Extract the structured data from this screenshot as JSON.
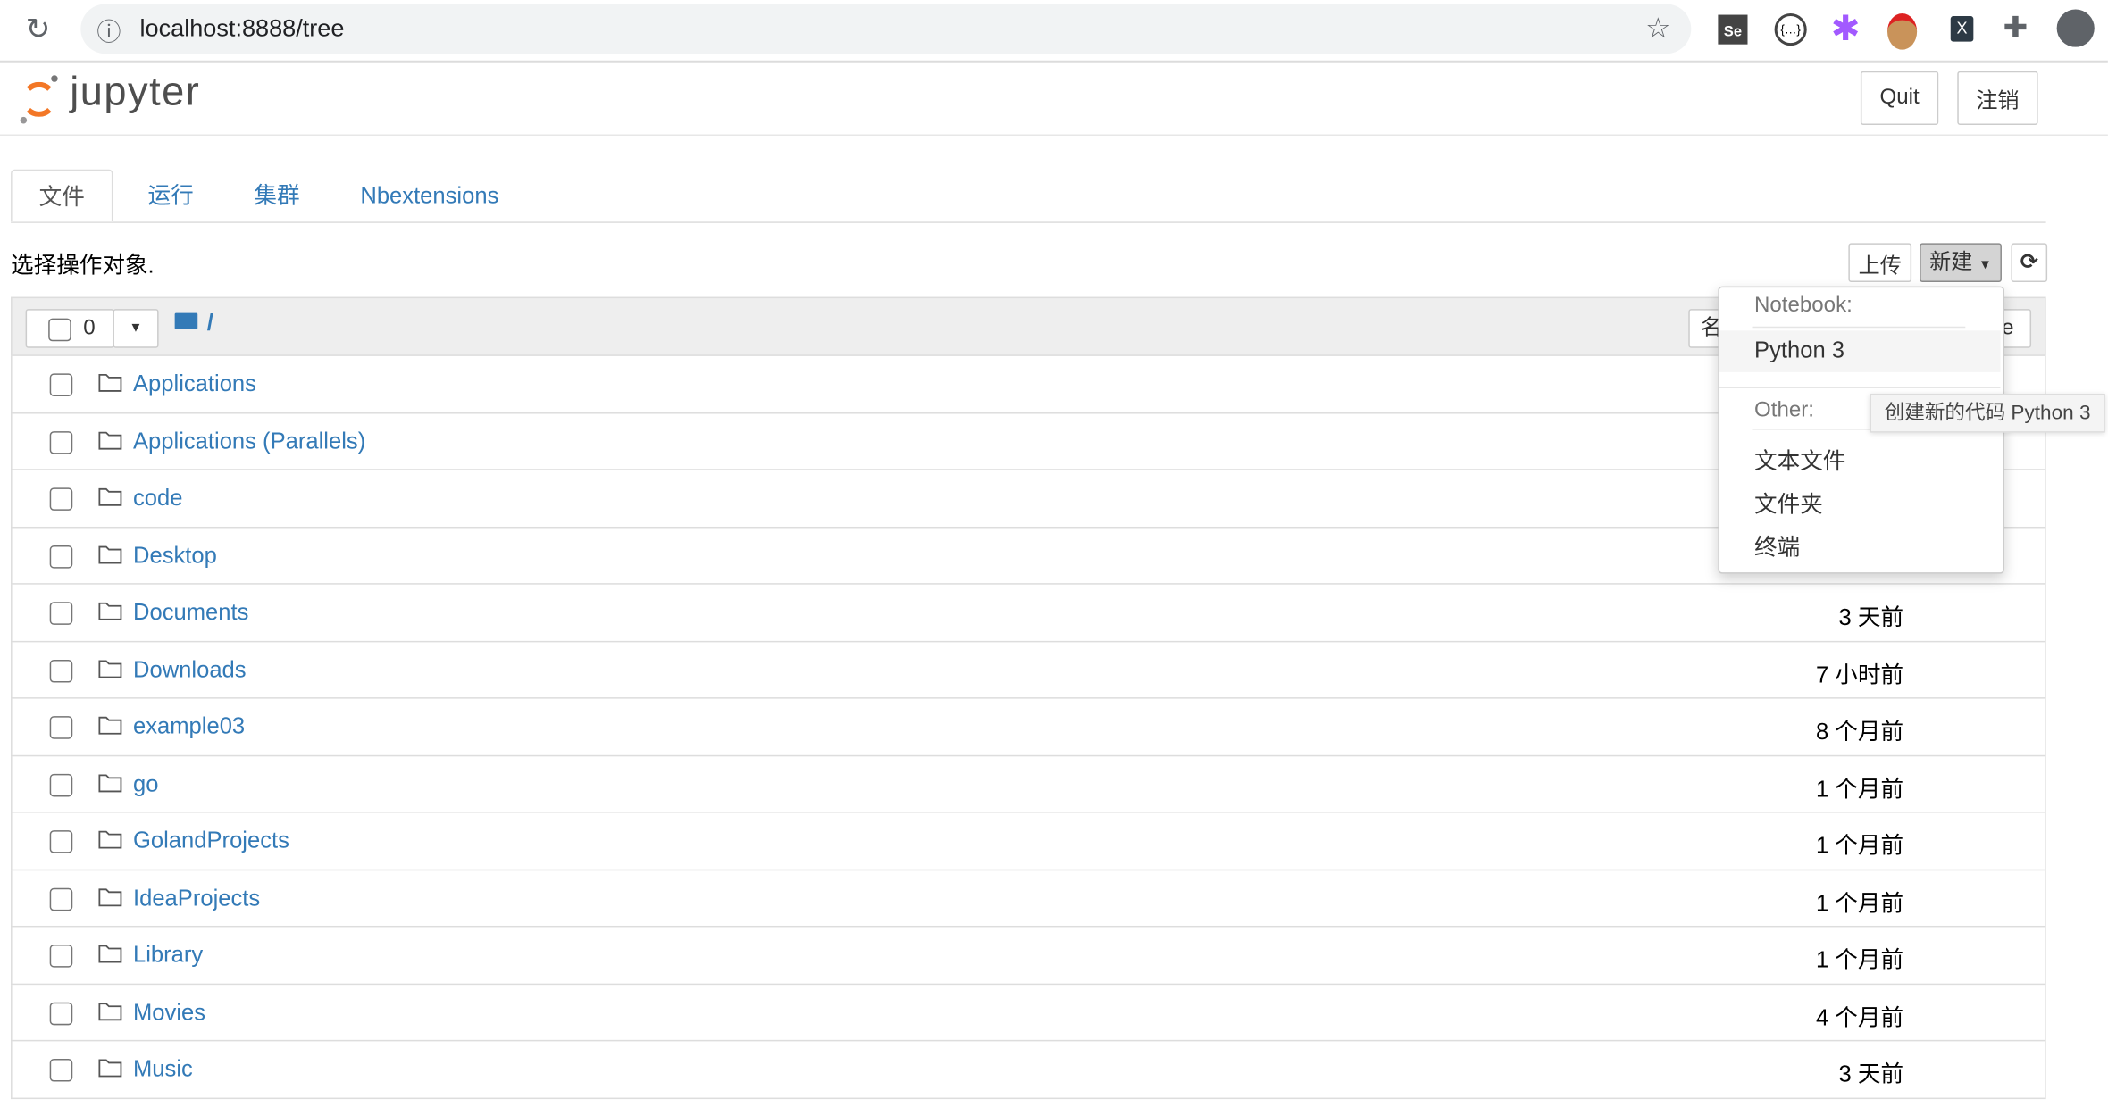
{
  "browser": {
    "url": "localhost:8888/tree",
    "extensions": [
      "selenium-icon",
      "json-viewer-icon",
      "figma-icon",
      "santa-icon",
      "x-extension-icon",
      "puzzle-icon"
    ]
  },
  "header": {
    "logo_text": "jupyter",
    "quit": "Quit",
    "logout": "注销",
    "brand_color": "#f37726"
  },
  "tabs": [
    {
      "label": "文件",
      "active": true
    },
    {
      "label": "运行"
    },
    {
      "label": "集群"
    },
    {
      "label": "Nbextensions"
    }
  ],
  "toolbar": {
    "hint": "选择操作对象.",
    "upload": "上传",
    "new": "新建"
  },
  "list_header": {
    "selected_count": "0",
    "path": "/",
    "sort_name": "名",
    "sort_size": "ze"
  },
  "rows": [
    {
      "name": "Applications",
      "time": ""
    },
    {
      "name": "Applications (Parallels)",
      "time": ""
    },
    {
      "name": "code",
      "time": ""
    },
    {
      "name": "Desktop",
      "time": ""
    },
    {
      "name": "Documents",
      "time": "3 天前"
    },
    {
      "name": "Downloads",
      "time": "7 小时前"
    },
    {
      "name": "example03",
      "time": "8 个月前"
    },
    {
      "name": "go",
      "time": "1 个月前"
    },
    {
      "name": "GolandProjects",
      "time": "1 个月前"
    },
    {
      "name": "IdeaProjects",
      "time": "1 个月前"
    },
    {
      "name": "Library",
      "time": "1 个月前"
    },
    {
      "name": "Movies",
      "time": "4 个月前"
    },
    {
      "name": "Music",
      "time": "3 天前"
    }
  ],
  "new_menu": {
    "notebook_header": "Notebook:",
    "python": "Python 3",
    "other_header": "Other:",
    "items": [
      "文本文件",
      "文件夹",
      "终端"
    ],
    "tooltip": "创建新的代码 Python 3"
  },
  "colors": {
    "link": "#337ab7"
  }
}
